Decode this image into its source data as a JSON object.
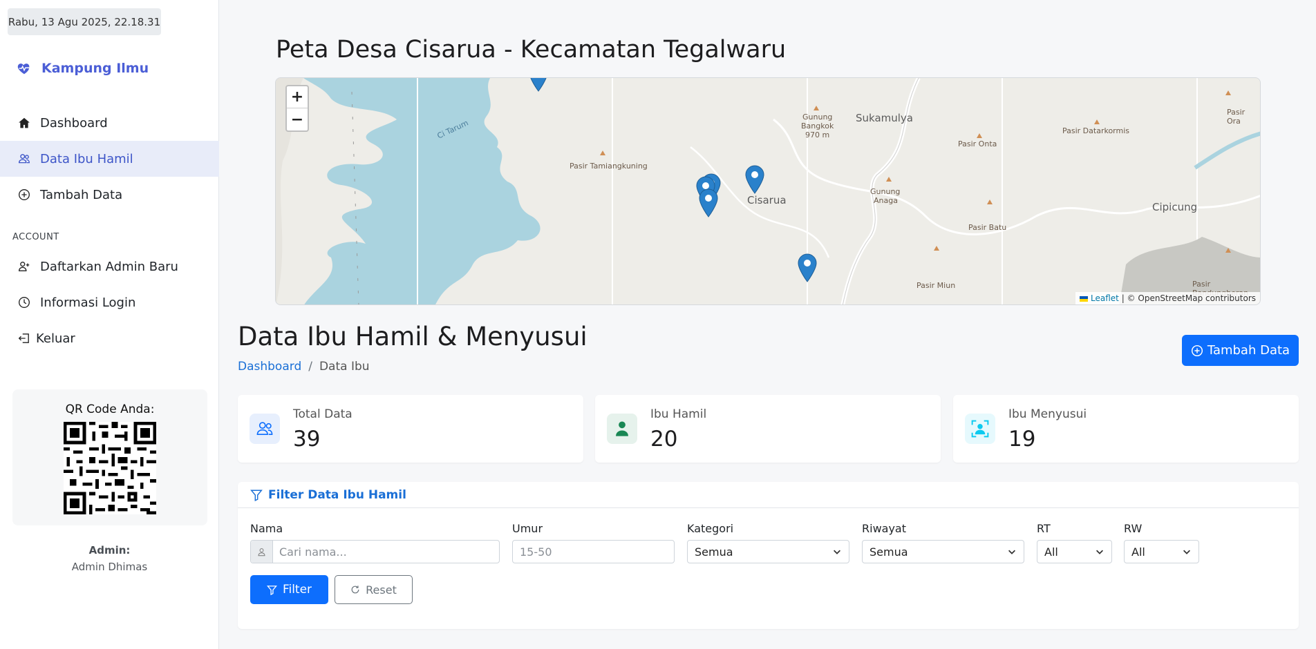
{
  "sidebar": {
    "datetime": "Rabu, 13 Agu 2025, 22.18.31",
    "brand": "Kampung Ilmu",
    "nav": [
      {
        "label": "Dashboard",
        "icon": "house-icon"
      },
      {
        "label": "Data Ibu Hamil",
        "icon": "users-icon",
        "active": true
      },
      {
        "label": "Tambah Data",
        "icon": "plus-circle-icon"
      }
    ],
    "section_account": "ACCOUNT",
    "account_nav": [
      {
        "label": "Daftarkan Admin Baru",
        "icon": "user-plus-icon"
      },
      {
        "label": "Informasi Login",
        "icon": "clock-icon"
      },
      {
        "label": "Keluar",
        "icon": "logout-icon"
      }
    ],
    "qr_title": "QR Code Anda:",
    "admin_label": "Admin:",
    "admin_name": "Admin Dhimas"
  },
  "map": {
    "title": "Peta Desa Cisarua - Kecamatan Tegalwaru",
    "zoom_in": "+",
    "zoom_out": "−",
    "attribution_link": "Leaflet",
    "attribution_text": "| © OpenStreetMap contributors",
    "labels": {
      "ci_tarum": "Ci Tarum",
      "pasir_tamiangkuning": "Pasir Tamiangkuning",
      "gunung_bangkok_1": "Gunung",
      "gunung_bangkok_2": "Bangkok",
      "gunung_bangkok_3": "970 m",
      "sukamulya": "Sukamulya",
      "cisarua": "Cisarua",
      "pasir_onta": "Pasir Onta",
      "pasir_datarkormis": "Pasir Datarkormis",
      "pasir_ora": "Pasir Ora",
      "gunung_anaga_1": "Gunung",
      "gunung_anaga_2": "Anaga",
      "cipicung": "Cipicung",
      "pasir_batu": "Pasir Batu",
      "pasir_miun": "Pasir Miun",
      "pasir_bandungheran": "Pasir Bandungheran"
    },
    "marker_count": 5
  },
  "page": {
    "title": "Data Ibu Hamil & Menyusui",
    "breadcrumb_home": "Dashboard",
    "breadcrumb_sep": "/",
    "breadcrumb_current": "Data Ibu",
    "add_button": "Tambah Data"
  },
  "stats": [
    {
      "label": "Total Data",
      "value": "39",
      "icon": "users-icon",
      "color": "#0d6efd"
    },
    {
      "label": "Ibu Hamil",
      "value": "20",
      "icon": "person-icon",
      "color": "#198754"
    },
    {
      "label": "Ibu Menyusui",
      "value": "19",
      "icon": "person-bounding-icon",
      "color": "#0dcaf0"
    }
  ],
  "filter": {
    "title": "Filter Data Ibu Hamil",
    "nama_label": "Nama",
    "nama_placeholder": "Cari nama...",
    "umur_label": "Umur",
    "umur_placeholder": "15-50",
    "kategori_label": "Kategori",
    "kategori_value": "Semua",
    "riwayat_label": "Riwayat",
    "riwayat_value": "Semua",
    "rt_label": "RT",
    "rt_value": "All",
    "rw_label": "RW",
    "rw_value": "All",
    "filter_button": "Filter",
    "reset_button": "Reset"
  }
}
